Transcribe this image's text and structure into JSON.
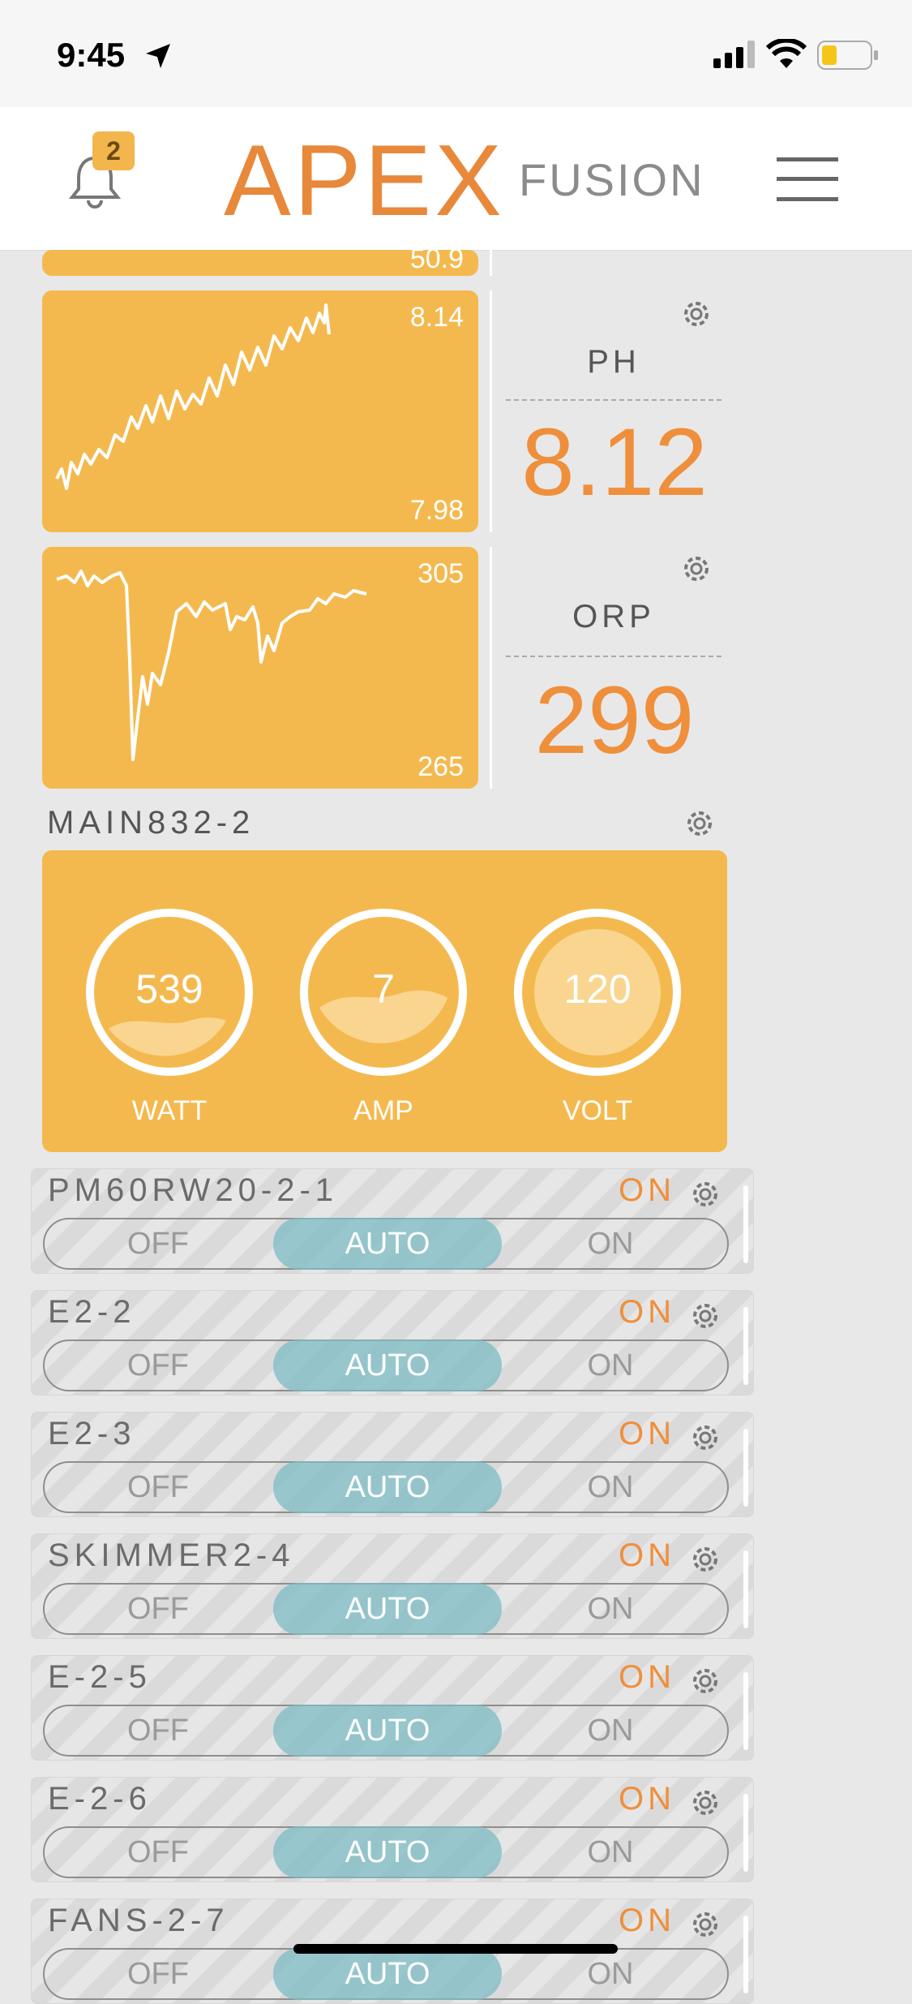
{
  "status_bar": {
    "time": "9:45"
  },
  "header": {
    "notification_count": "2",
    "logo_main": "APEX",
    "logo_sub": "FUSION"
  },
  "probes": [
    {
      "name": "PH",
      "value": "8.12",
      "chart_max": "8.14",
      "chart_min": "7.98"
    },
    {
      "name": "ORP",
      "value": "299",
      "chart_max": "305",
      "chart_min": "265"
    }
  ],
  "partial_tile": {
    "chart_min": "50.9"
  },
  "energy": {
    "title": "MAIN832-2",
    "gauges": [
      {
        "value": "539",
        "label": "WATT"
      },
      {
        "value": "7",
        "label": "AMP"
      },
      {
        "value": "120",
        "label": "VOLT"
      }
    ]
  },
  "switch_labels": {
    "off": "OFF",
    "auto": "AUTO",
    "on": "ON"
  },
  "outlets": [
    {
      "name": "PM60RW20-2-1",
      "state": "ON"
    },
    {
      "name": "E2-2",
      "state": "ON"
    },
    {
      "name": "E2-3",
      "state": "ON"
    },
    {
      "name": "SKIMMER2-4",
      "state": "ON"
    },
    {
      "name": "E-2-5",
      "state": "ON"
    },
    {
      "name": "E-2-6",
      "state": "ON"
    },
    {
      "name": "FANS-2-7",
      "state": "ON"
    }
  ],
  "colors": {
    "accent": "#ef8f3c",
    "tile": "#f4b94e",
    "auto": "#7cbcc4"
  }
}
